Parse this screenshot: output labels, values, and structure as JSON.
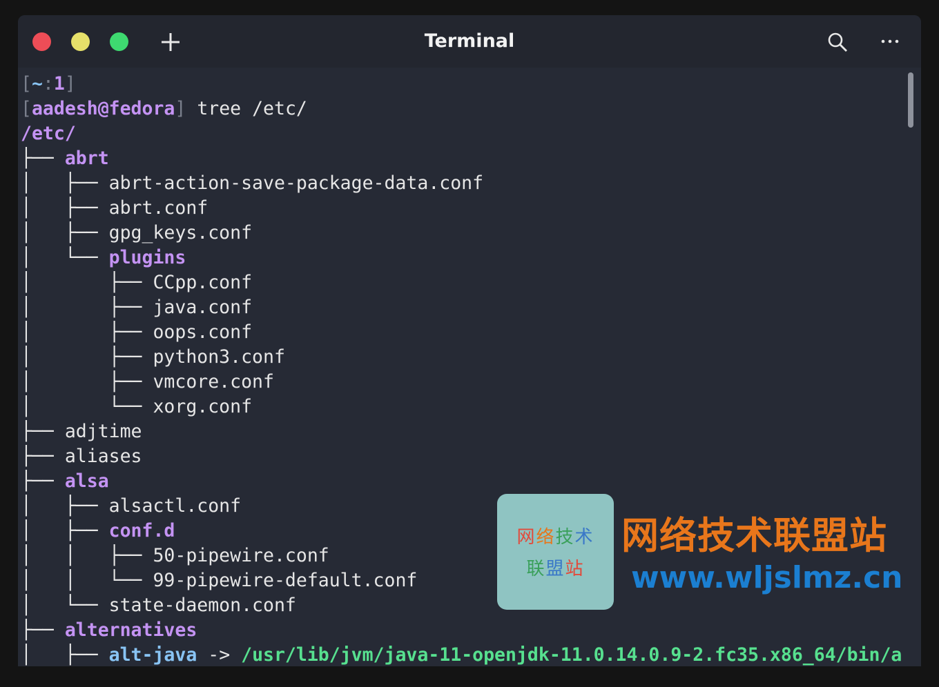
{
  "window": {
    "title": "Terminal"
  },
  "prompt": {
    "line1": {
      "open": "[",
      "path": "~",
      "sep": ":",
      "num": "1",
      "close": "]"
    },
    "line2": {
      "open": "[",
      "user": "aadesh@fedora",
      "close": "]",
      "command": " tree /etc/"
    }
  },
  "tree": {
    "root": "/etc/",
    "lines": [
      {
        "prefix": "├── ",
        "name": "abrt",
        "type": "dir"
      },
      {
        "prefix": "│   ├── ",
        "name": "abrt-action-save-package-data.conf",
        "type": "file"
      },
      {
        "prefix": "│   ├── ",
        "name": "abrt.conf",
        "type": "file"
      },
      {
        "prefix": "│   ├── ",
        "name": "gpg_keys.conf",
        "type": "file"
      },
      {
        "prefix": "│   └── ",
        "name": "plugins",
        "type": "dir"
      },
      {
        "prefix": "│       ├── ",
        "name": "CCpp.conf",
        "type": "file"
      },
      {
        "prefix": "│       ├── ",
        "name": "java.conf",
        "type": "file"
      },
      {
        "prefix": "│       ├── ",
        "name": "oops.conf",
        "type": "file"
      },
      {
        "prefix": "│       ├── ",
        "name": "python3.conf",
        "type": "file"
      },
      {
        "prefix": "│       ├── ",
        "name": "vmcore.conf",
        "type": "file"
      },
      {
        "prefix": "│       └── ",
        "name": "xorg.conf",
        "type": "file"
      },
      {
        "prefix": "├── ",
        "name": "adjtime",
        "type": "file"
      },
      {
        "prefix": "├── ",
        "name": "aliases",
        "type": "file"
      },
      {
        "prefix": "├── ",
        "name": "alsa",
        "type": "dir"
      },
      {
        "prefix": "│   ├── ",
        "name": "alsactl.conf",
        "type": "file"
      },
      {
        "prefix": "│   ├── ",
        "name": "conf.d",
        "type": "dir"
      },
      {
        "prefix": "│   │   ├── ",
        "name": "50-pipewire.conf",
        "type": "file"
      },
      {
        "prefix": "│   │   └── ",
        "name": "99-pipewire-default.conf",
        "type": "file"
      },
      {
        "prefix": "│   └── ",
        "name": "state-daemon.conf",
        "type": "file"
      },
      {
        "prefix": "├── ",
        "name": "alternatives",
        "type": "dir"
      },
      {
        "prefix": "│   ├── ",
        "name": "alt-java",
        "type": "link",
        "arrow": " -> ",
        "target": "/usr/lib/jvm/java-11-openjdk-11.0.14.0.9-2.fc35.x86_64/bin/a"
      }
    ]
  },
  "watermark": {
    "box_line1": "网络技术",
    "box_line2": "联盟站",
    "title": "网络技术联盟站",
    "url": "www.wljslmz.cn",
    "colors": {
      "title": "#e8761b",
      "url": "#1b7fd1",
      "box": "#8fc4c2"
    }
  },
  "colors": {
    "background": "#262a35",
    "titlebar": "#23262f",
    "directory": "#c493f3",
    "symlink": "#89c4f4",
    "link_target": "#57e08f",
    "traffic_red": "#ed4d57",
    "traffic_yellow": "#e6e06a",
    "traffic_green": "#3ed970"
  },
  "icons": [
    "close-dot",
    "minimize-dot",
    "maximize-dot",
    "new-tab-plus-icon",
    "search-icon",
    "more-options-icon"
  ]
}
